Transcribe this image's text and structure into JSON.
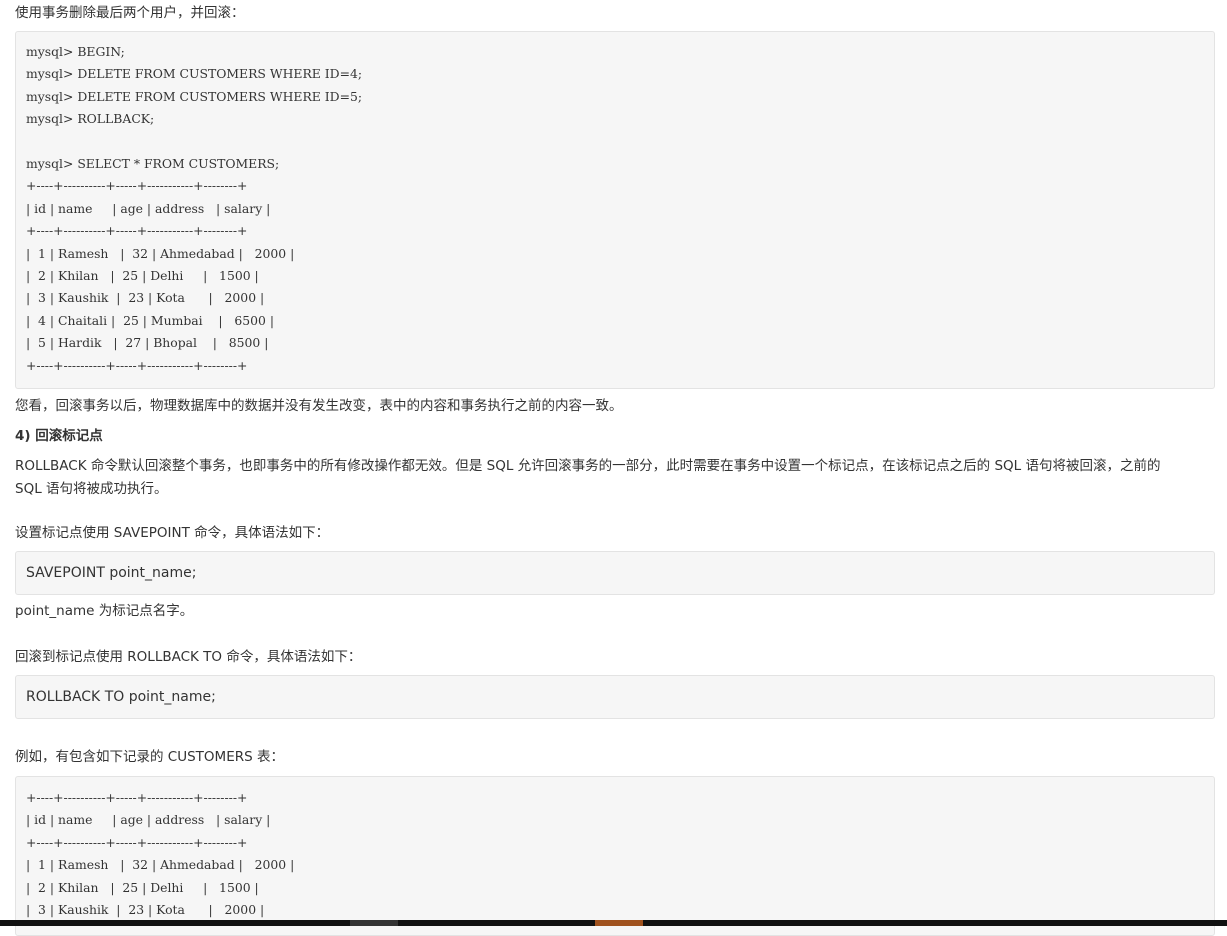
{
  "intro_1": "使用事务删除最后两个用户，并回滚：",
  "code_1": "mysql> BEGIN;\nmysql> DELETE FROM CUSTOMERS WHERE ID=4;\nmysql> DELETE FROM CUSTOMERS WHERE ID=5;\nmysql> ROLLBACK;\n\nmysql> SELECT * FROM CUSTOMERS;\n+----+----------+-----+-----------+--------+\n| id | name     | age | address   | salary |\n+----+----------+-----+-----------+--------+\n|  1 | Ramesh   |  32 | Ahmedabad |   2000 |\n|  2 | Khilan   |  25 | Delhi     |   1500 |\n|  3 | Kaushik  |  23 | Kota      |   2000 |\n|  4 | Chaitali |  25 | Mumbai    |   6500 |\n|  5 | Hardik   |  27 | Bhopal    |   8500 |\n+----+----------+-----+-----------+--------+",
  "after_rollback": "您看，回滚事务以后，物理数据库中的数据并没有发生改变，表中的内容和事务执行之前的内容一致。",
  "section_heading": "4) 回滚标记点",
  "section_desc_line1": "ROLLBACK 命令默认回滚整个事务，也即事务中的所有修改操作都无效。但是 SQL 允许回滚事务的一部分，此时需要在事务中设置一个标记点，在该标记点之后的 SQL 语句将被回滚，之前的",
  "section_desc_line2": "SQL 语句将被成功执行。",
  "savepoint_intro": "设置标记点使用 SAVEPOINT 命令，具体语法如下：",
  "savepoint_syntax": "SAVEPOINT point_name;",
  "point_name_note": "point_name 为标记点名字。",
  "rollback_to_intro": "回滚到标记点使用 ROLLBACK TO 命令，具体语法如下：",
  "rollback_to_syntax": "ROLLBACK TO point_name;",
  "example_intro": "例如，有包含如下记录的 CUSTOMERS 表：",
  "code_2": "+----+----------+-----+-----------+--------+\n| id | name     | age | address   | salary |\n+----+----------+-----+-----------+--------+\n|  1 | Ramesh   |  32 | Ahmedabad |   2000 |\n|  2 | Khilan   |  25 | Delhi     |   1500 |\n|  3 | Kaushik  |  23 | Kota      |   2000 |",
  "colors": {
    "text": "#333333",
    "code_bg": "#f6f6f6",
    "code_border": "#e3e3e3",
    "bottom_bar": "#111111",
    "bottom_accent_orange": "#a0521e",
    "bottom_accent_gray": "#333333"
  }
}
